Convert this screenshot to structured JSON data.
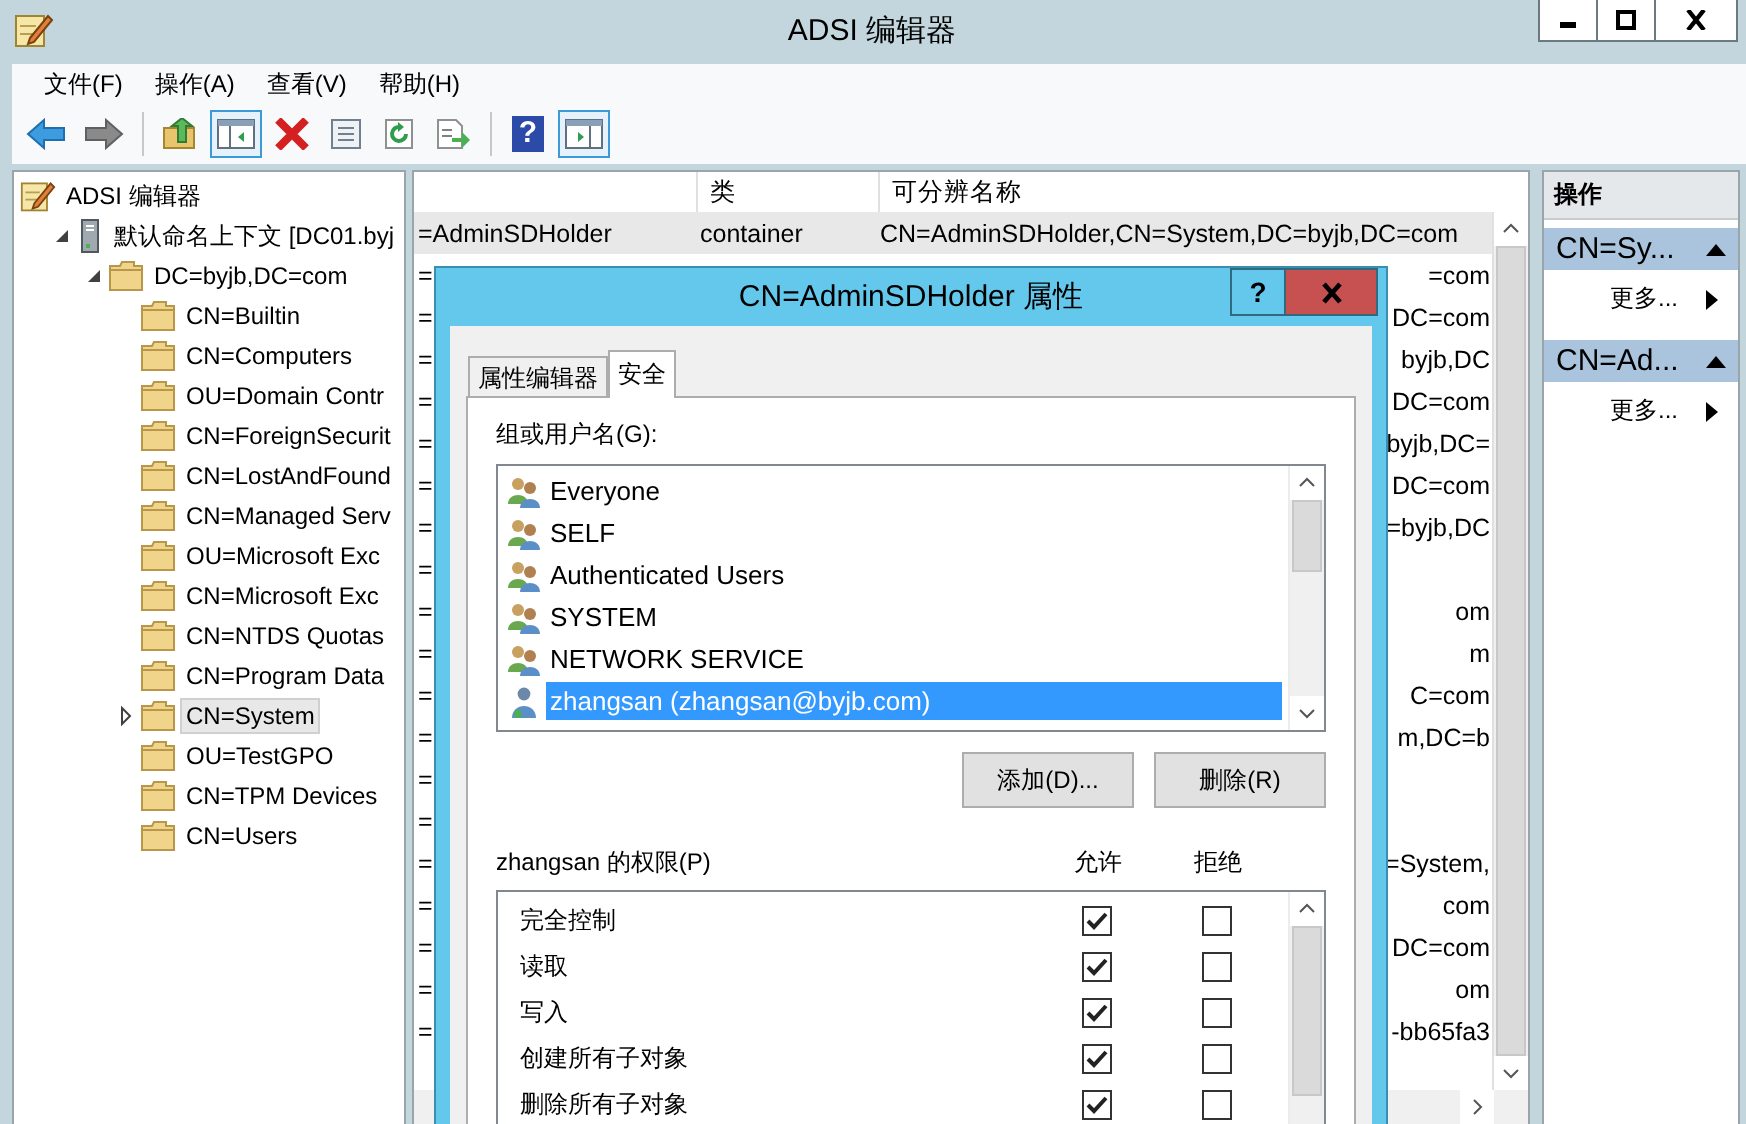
{
  "window": {
    "title": "ADSI 编辑器"
  },
  "menu": [
    "文件(F)",
    "操作(A)",
    "查看(V)",
    "帮助(H)"
  ],
  "toolbar": [
    {
      "kind": "back"
    },
    {
      "kind": "forward"
    },
    {
      "kind": "separator"
    },
    {
      "kind": "up"
    },
    {
      "kind": "tree-toggle",
      "on": true
    },
    {
      "kind": "delete"
    },
    {
      "kind": "properties"
    },
    {
      "kind": "refresh"
    },
    {
      "kind": "export"
    },
    {
      "kind": "separator"
    },
    {
      "kind": "help",
      "glyph": "?"
    },
    {
      "kind": "action-toggle",
      "on": true
    }
  ],
  "tree": {
    "label": "ADSI 编辑器",
    "kind": "root",
    "selected": false,
    "children": [
      {
        "label": "默认命名上下文 [DC01.byj",
        "kind": "server",
        "expanded": true,
        "selected": false,
        "children": [
          {
            "label": "DC=byjb,DC=com",
            "kind": "folder",
            "expanded": true,
            "selected": false,
            "children": [
              {
                "label": "CN=Builtin",
                "kind": "folder",
                "selected": false
              },
              {
                "label": "CN=Computers",
                "kind": "folder",
                "selected": false
              },
              {
                "label": "OU=Domain Contr",
                "kind": "folder",
                "selected": false
              },
              {
                "label": "CN=ForeignSecurit",
                "kind": "folder",
                "selected": false
              },
              {
                "label": "CN=LostAndFound",
                "kind": "folder",
                "selected": false
              },
              {
                "label": "CN=Managed Serv",
                "kind": "folder",
                "selected": false
              },
              {
                "label": "OU=Microsoft Exc",
                "kind": "folder",
                "selected": false
              },
              {
                "label": "CN=Microsoft Exc",
                "kind": "folder",
                "selected": false
              },
              {
                "label": "CN=NTDS Quotas",
                "kind": "folder",
                "selected": false
              },
              {
                "label": "CN=Program Data",
                "kind": "folder",
                "selected": false
              },
              {
                "label": "CN=System",
                "kind": "folder",
                "expanded": false,
                "selected": true
              },
              {
                "label": "OU=TestGPO",
                "kind": "folder",
                "selected": false
              },
              {
                "label": "CN=TPM Devices",
                "kind": "folder",
                "selected": false
              },
              {
                "label": "CN=Users",
                "kind": "folder",
                "selected": false
              }
            ]
          }
        ]
      }
    ]
  },
  "list": {
    "columns": [
      "类",
      "可分辨名称"
    ],
    "rows": [
      {
        "name": "=AdminSDHolder",
        "class": "container",
        "dn": "CN=AdminSDHolder,CN=System,DC=byjb,DC=com",
        "selected": true
      },
      {
        "name": "=",
        "dn": "=com",
        "selected": false
      },
      {
        "name": "=",
        "dn": "DC=com",
        "selected": false
      },
      {
        "name": "=",
        "dn": "byjb,DC",
        "selected": false
      },
      {
        "name": "=",
        "dn": "DC=com",
        "selected": false
      },
      {
        "name": "=",
        "dn": "byjb,DC=",
        "selected": false
      },
      {
        "name": "=",
        "dn": "DC=com",
        "selected": false
      },
      {
        "name": "=",
        "dn": "=byjb,DC",
        "selected": false
      },
      {
        "name": "=",
        "selected": false
      },
      {
        "name": "=",
        "dn": "om",
        "selected": false
      },
      {
        "name": "=",
        "dn": "m",
        "selected": false
      },
      {
        "name": "=",
        "dn": "C=com",
        "selected": false
      },
      {
        "name": "=",
        "dn": "m,DC=b",
        "selected": false
      },
      {
        "name": "=",
        "selected": false
      },
      {
        "name": "=",
        "selected": false
      },
      {
        "name": "=",
        "dn": "=System,",
        "selected": false
      },
      {
        "name": "=",
        "dn": "com",
        "selected": false
      },
      {
        "name": "=",
        "dn": "DC=com",
        "selected": false
      },
      {
        "name": "=",
        "dn": "om",
        "selected": false
      },
      {
        "name": "=",
        "dn": "-bb65fa3",
        "selected": false
      }
    ]
  },
  "actions": {
    "title": "操作",
    "sections": [
      {
        "title": "CN=Sy...",
        "expanded": true,
        "items": [
          "更多..."
        ]
      },
      {
        "title": "CN=Ad...",
        "expanded": true,
        "items": [
          "更多..."
        ]
      }
    ]
  },
  "dialog": {
    "title": "CN=AdminSDHolder 属性",
    "help_button": "?",
    "tabs": [
      {
        "label": "属性编辑器",
        "selected": false
      },
      {
        "label": "安全",
        "selected": true
      }
    ],
    "principals_label": "组或用户名(G):",
    "principals": [
      {
        "name": "Everyone",
        "kind": "group",
        "selected": false
      },
      {
        "name": "SELF",
        "kind": "group",
        "selected": false
      },
      {
        "name": "Authenticated Users",
        "kind": "group",
        "selected": false
      },
      {
        "name": "SYSTEM",
        "kind": "group",
        "selected": false
      },
      {
        "name": "NETWORK SERVICE",
        "kind": "group",
        "selected": false
      },
      {
        "name": "zhangsan (zhangsan@byjb.com)",
        "kind": "user",
        "selected": true
      }
    ],
    "buttons": [
      "添加(D)...",
      "删除(R)"
    ],
    "permissions_label": "zhangsan 的权限(P)",
    "allow_label": "允许",
    "deny_label": "拒绝",
    "permissions": [
      {
        "name": "完全控制",
        "allow": true,
        "deny": false
      },
      {
        "name": "读取",
        "allow": true,
        "deny": false
      },
      {
        "name": "写入",
        "allow": true,
        "deny": false
      },
      {
        "name": "创建所有子对象",
        "allow": true,
        "deny": false
      },
      {
        "name": "删除所有子对象",
        "allow": true,
        "deny": false
      }
    ]
  }
}
